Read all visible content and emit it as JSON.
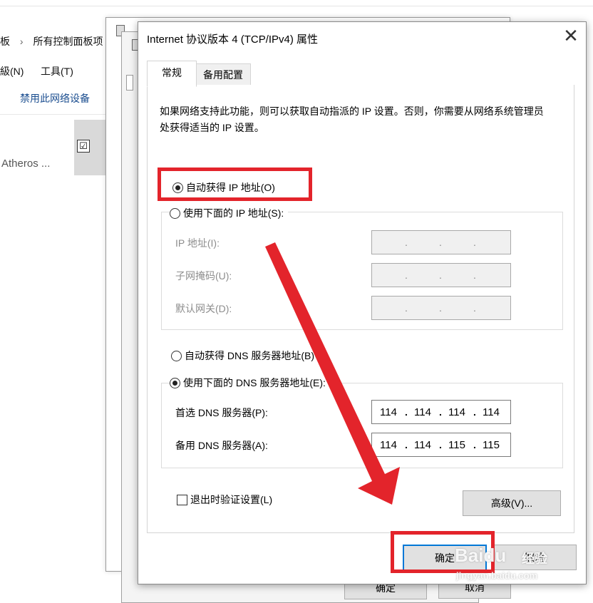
{
  "background": {
    "breadcrumb_left": "板",
    "breadcrumb_sep": "›",
    "breadcrumb_item": "所有控制面板项",
    "menu_view": "級(N)",
    "menu_tools": "工具(T)",
    "toolbar_disable": "禁用此网络设备",
    "adapter_text": "Atheros ...",
    "check_mark": "☑"
  },
  "behind_buttons": {
    "ok": "确定",
    "cancel": "取消"
  },
  "dialog": {
    "title": "Internet 协议版本 4 (TCP/IPv4) 属性",
    "close_glyph": "✕",
    "tabs": [
      "常规",
      "备用配置"
    ],
    "description": "如果网络支持此功能，则可以获取自动指派的 IP 设置。否则，你需要从网络系统管理员处获得适当的 IP 设置。",
    "ip_auto_label": "自动获得 IP 地址(O)",
    "ip_manual_label": "使用下面的 IP 地址(S):",
    "ip_fields": [
      {
        "label": "IP 地址(I):",
        "segments": [
          "",
          "",
          "",
          ""
        ]
      },
      {
        "label": "子网掩码(U):",
        "segments": [
          "",
          "",
          "",
          ""
        ]
      },
      {
        "label": "默认网关(D):",
        "segments": [
          "",
          "",
          "",
          ""
        ]
      }
    ],
    "dns_auto_label": "自动获得 DNS 服务器地址(B)",
    "dns_manual_label": "使用下面的 DNS 服务器地址(E):",
    "dns_fields": [
      {
        "label": "首选 DNS 服务器(P):",
        "segments": [
          "114",
          "114",
          "114",
          "114"
        ]
      },
      {
        "label": "备用 DNS 服务器(A):",
        "segments": [
          "114",
          "114",
          "115",
          "115"
        ]
      }
    ],
    "validate_label": "退出时验证设置(L)",
    "advanced_button": "高级(V)...",
    "ok_button": "确定",
    "cancel_button": "取消",
    "selected_ip_mode": "auto",
    "selected_dns_mode": "manual",
    "validate_checked": false
  },
  "annotation": {
    "color": "#e3242b"
  },
  "watermark": {
    "brand": "Baidu",
    "brand_cn": "经验",
    "url": "jingyan.baidu.com"
  }
}
